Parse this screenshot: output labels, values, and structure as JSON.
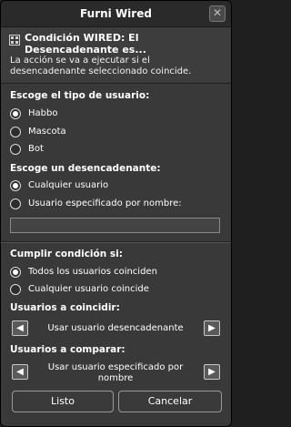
{
  "window": {
    "title": "Furni Wired",
    "close_symbol": "✕"
  },
  "condition": {
    "title": "Condición WIRED: El Desencadenante es...",
    "description": "La acción se va a ejecutar si el desencadenante seleccionado coincide."
  },
  "user_type": {
    "label": "Escoge el tipo de usuario:",
    "options": [
      {
        "label": "Habbo",
        "selected": true
      },
      {
        "label": "Mascota",
        "selected": false
      },
      {
        "label": "Bot",
        "selected": false
      }
    ]
  },
  "trigger": {
    "label": "Escoge un desencadenante:",
    "options": [
      {
        "label": "Cualquier usuario",
        "selected": true
      },
      {
        "label": "Usuario especificado por nombre:",
        "selected": false
      }
    ],
    "name_input_value": ""
  },
  "fulfill": {
    "label": "Cumplir condición si:",
    "options": [
      {
        "label": "Todos los usuarios coinciden",
        "selected": true
      },
      {
        "label": "Cualquier usuario coincide",
        "selected": false
      }
    ]
  },
  "match_users": {
    "label": "Usuarios a coincidir:",
    "value": "Usar usuario desencadenante"
  },
  "compare_users": {
    "label": "Usuarios a comparar:",
    "value": "Usar usuario especificado por nombre"
  },
  "buttons": {
    "ok": "Listo",
    "cancel": "Cancelar"
  },
  "icons": {
    "left_arrow": "◀",
    "right_arrow": "▶"
  }
}
